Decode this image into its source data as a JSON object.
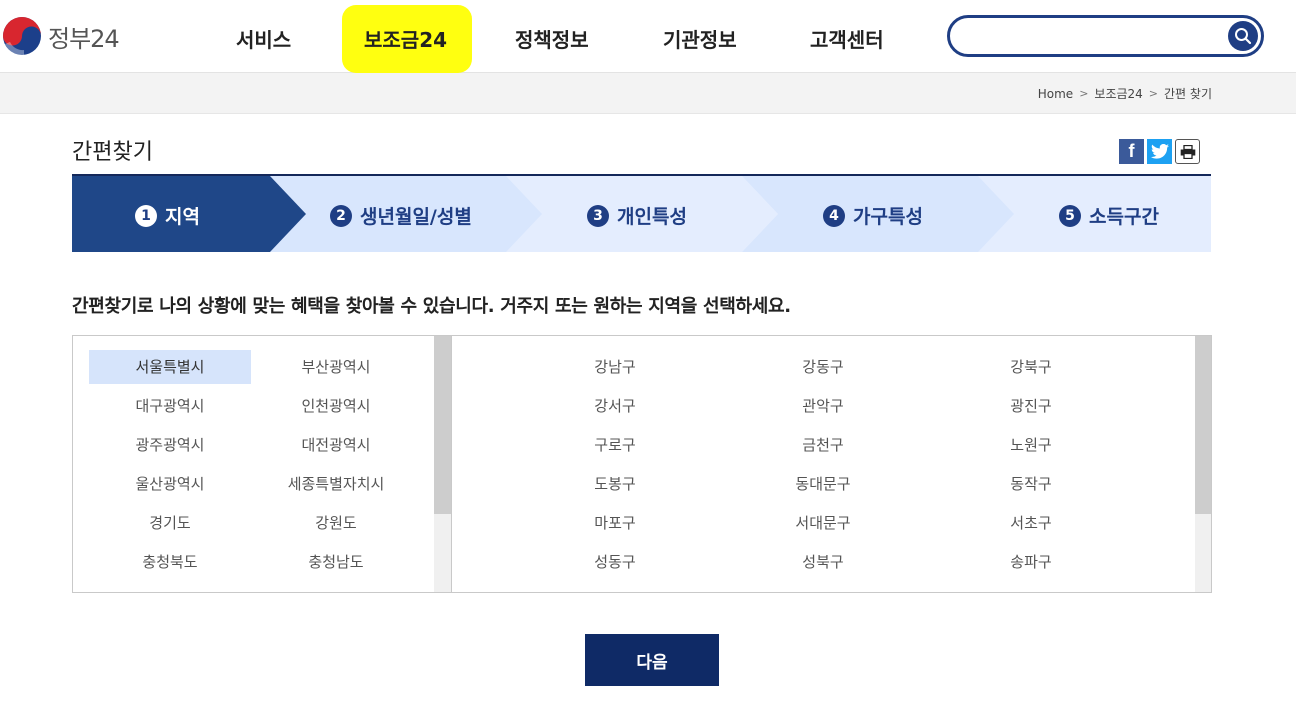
{
  "header": {
    "logo_text": "정부24",
    "nav": [
      "서비스",
      "보조금24",
      "정책정보",
      "기관정보",
      "고객센터"
    ],
    "search_placeholder": ""
  },
  "breadcrumb": {
    "items": [
      "Home",
      "보조금24",
      "간편 찾기"
    ]
  },
  "page": {
    "title": "간편찾기",
    "share": {
      "facebook": "f"
    }
  },
  "steps": [
    {
      "num": "1",
      "label": "지역",
      "active": true
    },
    {
      "num": "2",
      "label": "생년월일/성별",
      "active": false
    },
    {
      "num": "3",
      "label": "개인특성",
      "active": false
    },
    {
      "num": "4",
      "label": "가구특성",
      "active": false
    },
    {
      "num": "5",
      "label": "소득구간",
      "active": false
    }
  ],
  "instruction": "간편찾기로 나의 상황에 맞는 혜택을 찾아볼 수 있습니다. 거주지 또는 원하는 지역을 선택하세요.",
  "regions": [
    "서울특별시",
    "부산광역시",
    "대구광역시",
    "인천광역시",
    "광주광역시",
    "대전광역시",
    "울산광역시",
    "세종특별자치시",
    "경기도",
    "강원도",
    "충청북도",
    "충청남도"
  ],
  "selected_region": "서울특별시",
  "districts": [
    "강남구",
    "강동구",
    "강북구",
    "강서구",
    "관악구",
    "광진구",
    "구로구",
    "금천구",
    "노원구",
    "도봉구",
    "동대문구",
    "동작구",
    "마포구",
    "서대문구",
    "서초구",
    "성동구",
    "성북구",
    "송파구"
  ],
  "buttons": {
    "next": "다음"
  },
  "colors": {
    "primary": "#1f3e84",
    "step_active": "#1f4788",
    "step_light": "#d8e6fd",
    "highlight": "#ffff10",
    "button": "#0f2a66"
  }
}
